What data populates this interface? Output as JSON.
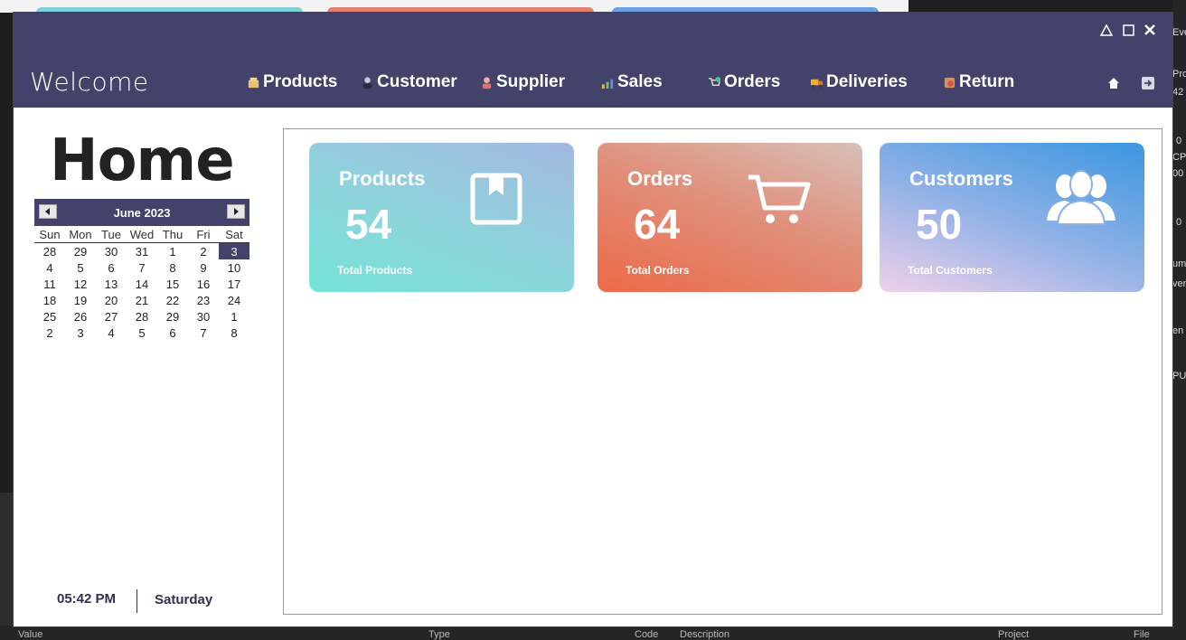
{
  "window": {
    "welcome": "Welcome",
    "controls": {
      "minimize_icon": "triangle-icon",
      "maximize_icon": "square-icon",
      "close_icon": "close-icon"
    }
  },
  "nav": [
    {
      "label": "Products",
      "icon": "box-icon",
      "color": "#e8c070"
    },
    {
      "label": "Customer",
      "icon": "user-icon",
      "color": "#b0b0c8"
    },
    {
      "label": "Supplier",
      "icon": "supplier-icon",
      "color": "#e07070"
    },
    {
      "label": "Sales",
      "icon": "chart-icon",
      "color": "#7cc070"
    },
    {
      "label": "Orders",
      "icon": "cart-icon",
      "color": "#50c090"
    },
    {
      "label": "Deliveries",
      "icon": "truck-icon",
      "color": "#f0b030"
    },
    {
      "label": "Return",
      "icon": "return-icon",
      "color": "#d09060"
    }
  ],
  "sidebar": {
    "home_title": "Home",
    "calendar": {
      "month_label": "June 2023",
      "weekdays": [
        "Sun",
        "Mon",
        "Tue",
        "Wed",
        "Thu",
        "Fri",
        "Sat"
      ],
      "weeks": [
        [
          "28",
          "29",
          "30",
          "31",
          "1",
          "2",
          "3"
        ],
        [
          "4",
          "5",
          "6",
          "7",
          "8",
          "9",
          "10"
        ],
        [
          "11",
          "12",
          "13",
          "14",
          "15",
          "16",
          "17"
        ],
        [
          "18",
          "19",
          "20",
          "21",
          "22",
          "23",
          "24"
        ],
        [
          "25",
          "26",
          "27",
          "28",
          "29",
          "30",
          "1"
        ],
        [
          "2",
          "3",
          "4",
          "5",
          "6",
          "7",
          "8"
        ]
      ],
      "selected": "3"
    },
    "time": "05:42 PM",
    "day": "Saturday"
  },
  "cards": [
    {
      "title": "Products",
      "value": "54",
      "subtitle": "Total Products",
      "icon": "box-outline-icon"
    },
    {
      "title": "Orders",
      "value": "64",
      "subtitle": "Total Orders",
      "icon": "cart-icon"
    },
    {
      "title": "Customers",
      "value": "50",
      "subtitle": "Total Customers",
      "icon": "users-icon"
    }
  ],
  "background": {
    "bottom_labels": [
      "Value",
      "Type",
      "Code",
      "Description",
      "Project",
      "File"
    ],
    "right_labels": [
      "Eve",
      "Pro",
      "42",
      "0",
      "CPU",
      "00",
      "0",
      "um",
      "ven",
      "en",
      "PU"
    ]
  },
  "colors": {
    "accent": "#42426a"
  }
}
